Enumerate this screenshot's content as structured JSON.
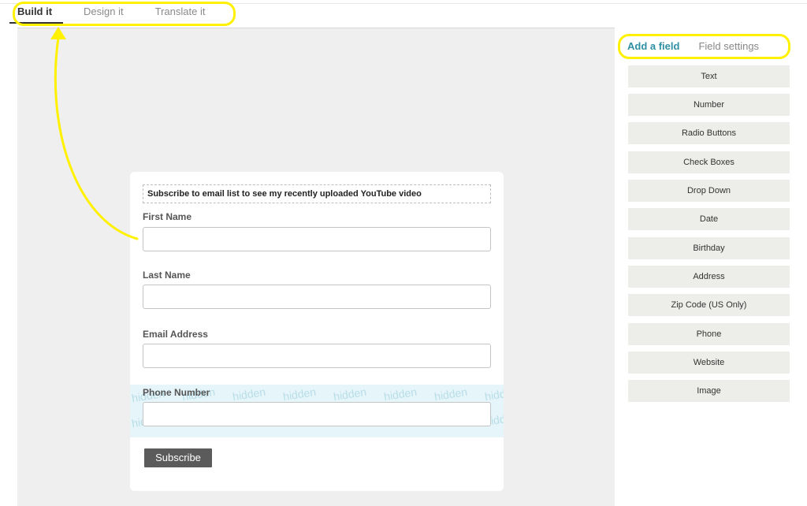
{
  "top_tabs": [
    {
      "label": "Build it",
      "active": true
    },
    {
      "label": "Design it",
      "active": false
    },
    {
      "label": "Translate it",
      "active": false
    }
  ],
  "form": {
    "header_text": "Subscribe to email list to see my recently uploaded YouTube video",
    "fields": [
      {
        "label": "First Name"
      },
      {
        "label": "Last Name"
      },
      {
        "label": "Email Address"
      },
      {
        "label": "Phone Number",
        "hidden": true
      }
    ],
    "hidden_watermark": "hidden",
    "submit_label": "Subscribe"
  },
  "side_panel": {
    "tabs": [
      {
        "label": "Add a field",
        "active": true
      },
      {
        "label": "Field settings",
        "active": false
      }
    ],
    "field_types": [
      "Text",
      "Number",
      "Radio Buttons",
      "Check Boxes",
      "Drop Down",
      "Date",
      "Birthday",
      "Address",
      "Zip Code (US Only)",
      "Phone",
      "Website",
      "Image"
    ]
  },
  "colors": {
    "annotation": "#fff100",
    "active_side_tab": "#2f8fa3",
    "submit_button": "#5b5b5b",
    "hidden_field_band": "#e5f5fa"
  }
}
